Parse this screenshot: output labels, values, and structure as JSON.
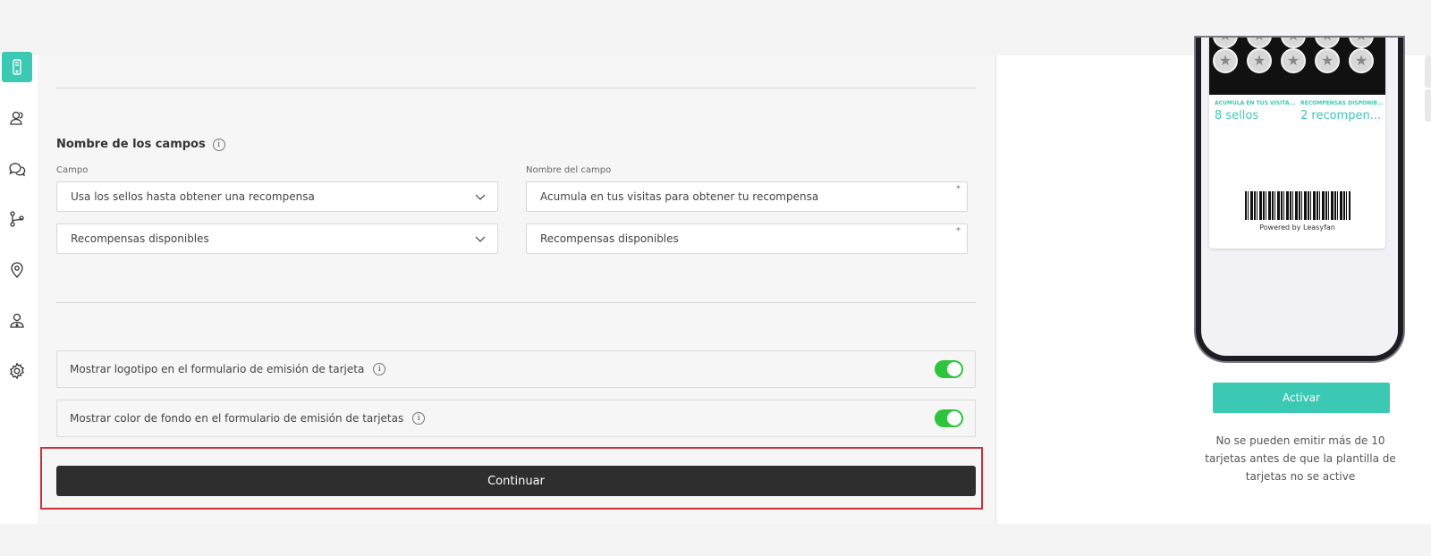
{
  "sidebar": {
    "items": [
      {
        "icon": "phone-icon",
        "active": true
      },
      {
        "icon": "users-icon",
        "active": false
      },
      {
        "icon": "chat-icon",
        "active": false
      },
      {
        "icon": "flow-icon",
        "active": false
      },
      {
        "icon": "location-pin-icon",
        "active": false
      },
      {
        "icon": "user-download-icon",
        "active": false
      },
      {
        "icon": "gear-icon",
        "active": false
      }
    ],
    "accent_color": "#3cc9b3"
  },
  "form": {
    "section_title": "Nombre de los campos",
    "field_col_label": "Campo",
    "name_col_label": "Nombre del campo",
    "rows": [
      {
        "field": "Usa los sellos hasta obtener una recompensa",
        "name": "Acumula en tus visitas para obtener tu recompensa"
      },
      {
        "field": "Recompensas disponibles",
        "name": "Recompensas disponibles"
      }
    ],
    "required_mark": "*",
    "toggles": [
      {
        "label": "Mostrar logotipo en el formulario de emisión de tarjeta",
        "on": true
      },
      {
        "label": "Mostrar color de fondo en el formulario de emisión de tarjetas",
        "on": true
      }
    ],
    "continue_label": "Continuar"
  },
  "preview": {
    "label_left": "ACUMULA EN TUS VISITA...",
    "value_left": "8 sellos",
    "label_right": "RECOMPENSAS DISPONIB...",
    "value_right": "2 recompen...",
    "powered_by": "Powered by Leasyfan",
    "activate_label": "Activar",
    "note": "No se pueden emitir más de 10 tarjetas antes de que la plantilla de tarjetas no se active"
  },
  "colors": {
    "toggle_on": "#2ec43d",
    "continue_bg": "#2e2e2e",
    "highlight": "#c8323a"
  }
}
